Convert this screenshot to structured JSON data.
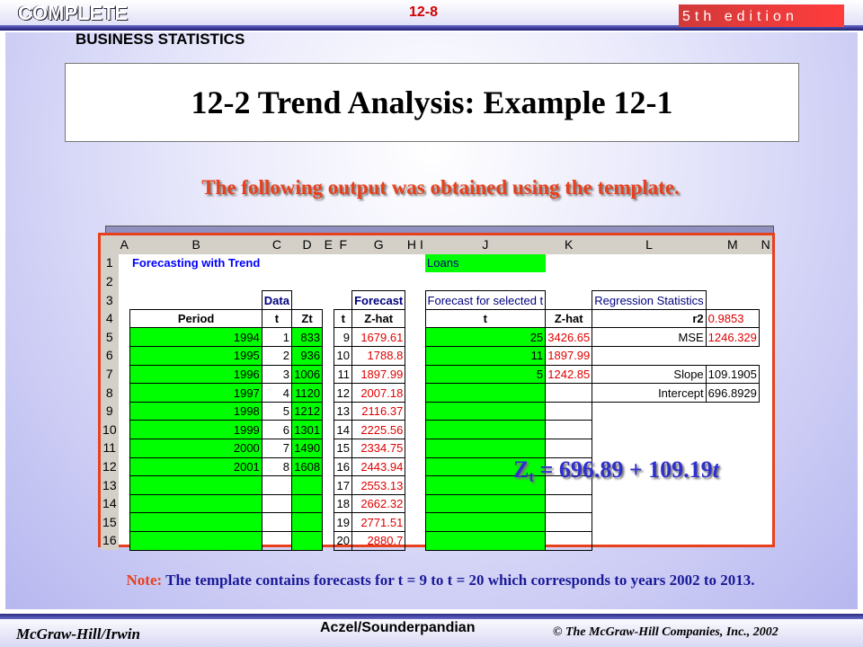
{
  "header": {
    "brand_complete": "COMPLETE",
    "brand_bs": "BUSINESS STATISTICS",
    "slide_number": "12-8",
    "edition": "5th edition"
  },
  "title": "12-2 Trend Analysis: Example 12-1",
  "subtitle": "The following output was obtained using the template.",
  "spreadsheet": {
    "col_headers": [
      "A",
      "B",
      "C",
      "D",
      "E",
      "F",
      "G",
      "H",
      "I",
      "J",
      "K",
      "L",
      "M",
      "N"
    ],
    "row_numbers": [
      "1",
      "2",
      "3",
      "4",
      "5",
      "6",
      "7",
      "8",
      "9",
      "10",
      "11",
      "12",
      "13",
      "14",
      "15",
      "16"
    ],
    "sheet_title": "Forecasting with Trend",
    "loans_label": "Loans",
    "data_header": "Data",
    "forecast_header": "Forecast",
    "selected_header": "Forecast for selected t",
    "period_label": "Period",
    "t_label": "t",
    "zt_label": "Zt",
    "zhat_label": "Z-hat",
    "data_rows": [
      {
        "period": "1994",
        "t": "1",
        "z": "833"
      },
      {
        "period": "1995",
        "t": "2",
        "z": "936"
      },
      {
        "period": "1996",
        "t": "3",
        "z": "1006"
      },
      {
        "period": "1997",
        "t": "4",
        "z": "1120"
      },
      {
        "period": "1998",
        "t": "5",
        "z": "1212"
      },
      {
        "period": "1999",
        "t": "6",
        "z": "1301"
      },
      {
        "period": "2000",
        "t": "7",
        "z": "1490"
      },
      {
        "period": "2001",
        "t": "8",
        "z": "1608"
      }
    ],
    "forecast_rows": [
      {
        "t": "9",
        "zhat": "1679.61"
      },
      {
        "t": "10",
        "zhat": "1788.8"
      },
      {
        "t": "11",
        "zhat": "1897.99"
      },
      {
        "t": "12",
        "zhat": "2007.18"
      },
      {
        "t": "13",
        "zhat": "2116.37"
      },
      {
        "t": "14",
        "zhat": "2225.56"
      },
      {
        "t": "15",
        "zhat": "2334.75"
      },
      {
        "t": "16",
        "zhat": "2443.94"
      },
      {
        "t": "17",
        "zhat": "2553.13"
      },
      {
        "t": "18",
        "zhat": "2662.32"
      },
      {
        "t": "19",
        "zhat": "2771.51"
      },
      {
        "t": "20",
        "zhat": "2880.7"
      }
    ],
    "selected_rows": [
      {
        "t": "25",
        "zhat": "3426.65"
      },
      {
        "t": "11",
        "zhat": "1897.99"
      },
      {
        "t": "5",
        "zhat": "1242.85"
      }
    ],
    "regression": {
      "title": "Regression Statistics",
      "r2_label": "r2",
      "r2": "0.9853",
      "mse_label": "MSE",
      "mse": "1246.329",
      "slope_label": "Slope",
      "slope": "109.1905",
      "intercept_label": "Intercept",
      "intercept": "696.8929"
    }
  },
  "formula": {
    "lhs": "Z",
    "sub": "t",
    "rhs": " = 696.89 + 109.19",
    "var": "t"
  },
  "note": {
    "label": "Note:",
    "text": " The template contains forecasts for t = 9 to t = 20 which corresponds to years 2002 to 2013."
  },
  "footer": {
    "left": "McGraw-Hill/Irwin",
    "center": "Aczel/Sounderpandian",
    "right": "© The McGraw-Hill Companies, Inc., 2002"
  },
  "colors": {
    "accent_red": "#e8401c",
    "green_cell": "#00ff00",
    "formula_blue": "#3030cc",
    "note_blue": "#1a1a99"
  }
}
